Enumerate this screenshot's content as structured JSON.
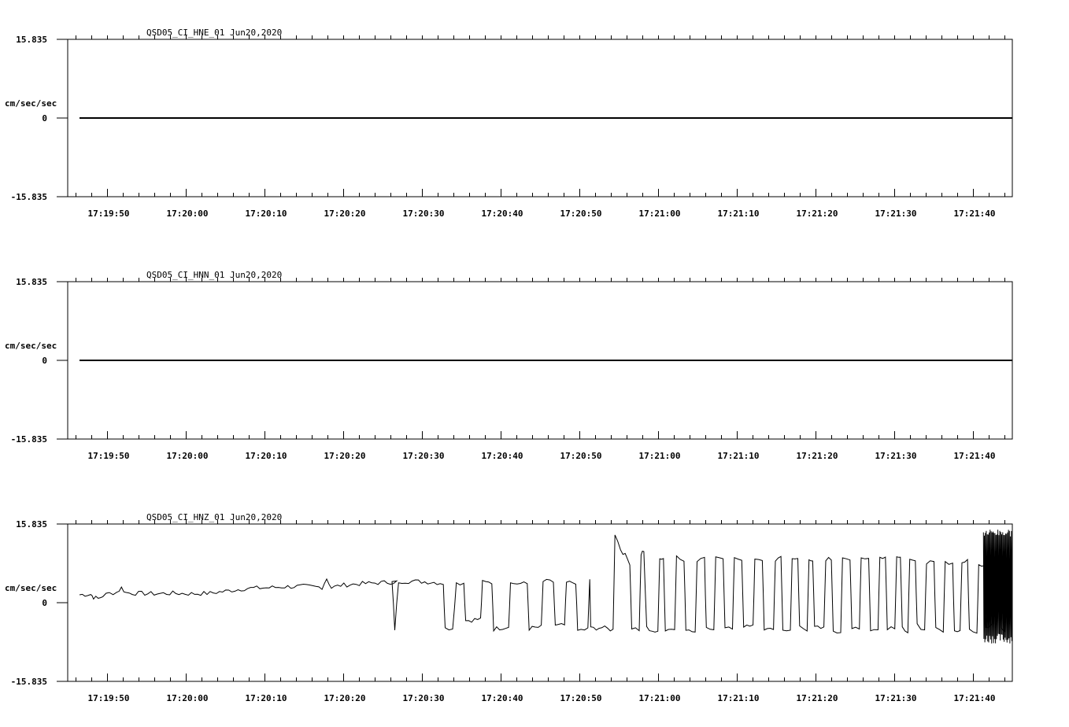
{
  "chart_data": [
    {
      "type": "line",
      "title": "QSD05_CI_HNE_01  Jun20,2020",
      "ylabel": "cm/sec/sec",
      "ylim": [
        -15.835,
        15.835
      ],
      "ytick_labels": [
        "15.835",
        "0",
        "-15.835"
      ],
      "x_tick_labels": [
        "17:19:50",
        "17:20:00",
        "17:20:10",
        "17:20:20",
        "17:20:30",
        "17:20:40",
        "17:20:50",
        "17:21:00",
        "17:21:10",
        "17:21:20",
        "17:21:30",
        "17:21:40"
      ],
      "xlim": [
        "17:19:45.0",
        "17:21:45.0"
      ],
      "series": [
        {
          "x_start": "17:19:46.5",
          "x_end": "17:21:45.0",
          "points": [
            [
              0,
              0.0
            ],
            [
              1,
              0.0
            ]
          ]
        }
      ]
    },
    {
      "type": "line",
      "title": "QSD05_CI_HNN_01  Jun20,2020",
      "ylabel": "cm/sec/sec",
      "ylim": [
        -15.835,
        15.835
      ],
      "ytick_labels": [
        "15.835",
        "0",
        "-15.835"
      ],
      "x_tick_labels": [
        "17:19:50",
        "17:20:00",
        "17:20:10",
        "17:20:20",
        "17:20:30",
        "17:20:40",
        "17:20:50",
        "17:21:00",
        "17:21:10",
        "17:21:20",
        "17:21:30",
        "17:21:40"
      ],
      "xlim": [
        "17:19:45.0",
        "17:21:45.0"
      ],
      "series": [
        {
          "x_start": "17:19:46.5",
          "x_end": "17:21:45.0",
          "points": [
            [
              0,
              0.0
            ],
            [
              1,
              0.0
            ]
          ]
        }
      ]
    },
    {
      "type": "line",
      "title": "QSD05_CI_HNZ_01  Jun20,2020",
      "ylabel": "cm/sec/sec",
      "ylim": [
        -15.835,
        15.835
      ],
      "ytick_labels": [
        "15.835",
        "0",
        "-15.835"
      ],
      "x_tick_labels": [
        "17:19:50",
        "17:20:00",
        "17:20:10",
        "17:20:20",
        "17:20:30",
        "17:20:40",
        "17:20:50",
        "17:21:00",
        "17:21:10",
        "17:21:20",
        "17:21:30",
        "17:21:40"
      ],
      "xlim": [
        "17:19:45.0",
        "17:21:45.0"
      ],
      "series": [
        {
          "x_start": "17:19:46.5",
          "x_end": "17:21:45.0",
          "points": [
            [
              0.0,
              1.6
            ],
            [
              0.012,
              1.7
            ],
            [
              0.015,
              1.1
            ],
            [
              0.02,
              0.8
            ],
            [
              0.025,
              1.4
            ],
            [
              0.032,
              1.9
            ],
            [
              0.04,
              2.1
            ],
            [
              0.045,
              3.0
            ],
            [
              0.05,
              2.0
            ],
            [
              0.06,
              1.9
            ],
            [
              0.08,
              1.8
            ],
            [
              0.1,
              1.9
            ],
            [
              0.12,
              1.8
            ],
            [
              0.14,
              1.9
            ],
            [
              0.16,
              2.4
            ],
            [
              0.18,
              2.9
            ],
            [
              0.2,
              3.0
            ],
            [
              0.22,
              3.2
            ],
            [
              0.24,
              3.3
            ],
            [
              0.26,
              3.1
            ],
            [
              0.265,
              4.9
            ],
            [
              0.27,
              3.0
            ],
            [
              0.28,
              3.5
            ],
            [
              0.3,
              3.8
            ],
            [
              0.32,
              4.0
            ],
            [
              0.34,
              4.2
            ],
            [
              0.335,
              4.1
            ],
            [
              0.338,
              -5.3
            ],
            [
              0.342,
              4.3
            ],
            [
              0.36,
              4.3
            ],
            [
              0.38,
              4.1
            ],
            [
              0.39,
              3.9
            ],
            [
              0.392,
              -5.3
            ],
            [
              0.4,
              -5.0
            ],
            [
              0.404,
              3.9
            ],
            [
              0.412,
              4.0
            ],
            [
              0.414,
              -3.6
            ],
            [
              0.43,
              -3.3
            ],
            [
              0.432,
              4.1
            ],
            [
              0.442,
              4.0
            ],
            [
              0.444,
              -5.3
            ],
            [
              0.46,
              -4.8
            ],
            [
              0.462,
              3.9
            ],
            [
              0.48,
              3.8
            ],
            [
              0.482,
              -5.2
            ],
            [
              0.495,
              -4.9
            ],
            [
              0.497,
              4.3
            ],
            [
              0.508,
              4.2
            ],
            [
              0.51,
              -4.7
            ],
            [
              0.52,
              -4.5
            ],
            [
              0.522,
              4.0
            ],
            [
              0.532,
              4.1
            ],
            [
              0.534,
              -5.6
            ],
            [
              0.545,
              -5.3
            ],
            [
              0.547,
              4.7
            ],
            [
              0.548,
              -5.2
            ],
            [
              0.56,
              -5.0
            ],
            [
              0.572,
              -5.5
            ],
            [
              0.574,
              13.9
            ],
            [
              0.58,
              10.8
            ],
            [
              0.585,
              9.5
            ],
            [
              0.59,
              8.0
            ],
            [
              0.592,
              -5.0
            ],
            [
              0.6,
              -5.4
            ],
            [
              0.602,
              9.8
            ],
            [
              0.605,
              10.2
            ],
            [
              0.608,
              -5.1
            ],
            [
              0.62,
              -6.1
            ],
            [
              0.622,
              9.2
            ],
            [
              0.626,
              8.9
            ],
            [
              0.628,
              -5.6
            ],
            [
              0.638,
              -5.0
            ],
            [
              0.64,
              9.2
            ],
            [
              0.648,
              8.3
            ],
            [
              0.65,
              -5.2
            ],
            [
              0.66,
              -5.8
            ],
            [
              0.662,
              8.6
            ],
            [
              0.67,
              8.8
            ],
            [
              0.672,
              -5.0
            ],
            [
              0.68,
              -5.3
            ],
            [
              0.682,
              9.0
            ],
            [
              0.69,
              9.1
            ],
            [
              0.692,
              -5.4
            ],
            [
              0.7,
              -5.2
            ],
            [
              0.702,
              8.8
            ],
            [
              0.71,
              8.9
            ],
            [
              0.712,
              -4.6
            ],
            [
              0.722,
              -4.9
            ],
            [
              0.724,
              8.9
            ],
            [
              0.732,
              8.8
            ],
            [
              0.734,
              -5.6
            ],
            [
              0.744,
              -5.2
            ],
            [
              0.746,
              8.7
            ],
            [
              0.752,
              8.9
            ],
            [
              0.754,
              -5.4
            ],
            [
              0.762,
              -5.6
            ],
            [
              0.764,
              9.2
            ],
            [
              0.77,
              8.6
            ],
            [
              0.772,
              -4.7
            ],
            [
              0.78,
              -5.8
            ],
            [
              0.782,
              9.0
            ],
            [
              0.786,
              8.5
            ],
            [
              0.788,
              -5.0
            ],
            [
              0.798,
              -5.2
            ],
            [
              0.8,
              8.8
            ],
            [
              0.806,
              8.7
            ],
            [
              0.808,
              -5.5
            ],
            [
              0.816,
              -5.9
            ],
            [
              0.818,
              8.6
            ],
            [
              0.826,
              8.5
            ],
            [
              0.828,
              -4.8
            ],
            [
              0.836,
              -5.0
            ],
            [
              0.838,
              9.2
            ],
            [
              0.846,
              8.9
            ],
            [
              0.848,
              -5.4
            ],
            [
              0.856,
              -5.6
            ],
            [
              0.858,
              9.5
            ],
            [
              0.864,
              9.2
            ],
            [
              0.866,
              -5.0
            ],
            [
              0.874,
              -4.9
            ],
            [
              0.876,
              9.4
            ],
            [
              0.88,
              9.0
            ],
            [
              0.882,
              -5.2
            ],
            [
              0.888,
              -5.6
            ],
            [
              0.89,
              8.3
            ],
            [
              0.896,
              8.2
            ],
            [
              0.898,
              -4.6
            ],
            [
              0.906,
              -5.3
            ],
            [
              0.908,
              8.2
            ],
            [
              0.916,
              8.4
            ],
            [
              0.918,
              -5.4
            ],
            [
              0.926,
              -5.6
            ],
            [
              0.928,
              8.1
            ],
            [
              0.936,
              8.2
            ],
            [
              0.938,
              -5.5
            ],
            [
              0.944,
              -5.4
            ],
            [
              0.946,
              8.0
            ],
            [
              0.952,
              8.3
            ],
            [
              0.954,
              -5.2
            ],
            [
              0.962,
              -5.8
            ],
            [
              0.964,
              7.8
            ],
            [
              0.97,
              7.6
            ],
            [
              0.972,
              -4.9
            ],
            [
              0.978,
              -4.6
            ],
            [
              0.98,
              7.4
            ],
            [
              0.986,
              7.6
            ],
            [
              0.988,
              -5.3
            ],
            [
              0.992,
              -5.6
            ],
            [
              0.994,
              7.2
            ],
            [
              0.998,
              7.3
            ]
          ],
          "burst_region": {
            "from": 0.969,
            "to": 1.0,
            "high": 14.8,
            "low": -8.2
          }
        }
      ]
    }
  ]
}
